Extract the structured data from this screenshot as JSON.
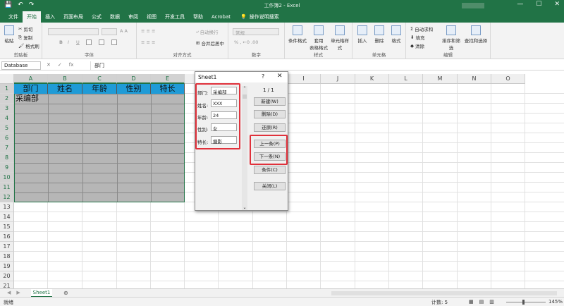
{
  "window": {
    "title": "工作簿2 - Excel",
    "qat": [
      "💾",
      "↶",
      "↷"
    ],
    "controls": [
      "—",
      "☐",
      "✕"
    ]
  },
  "tabs": [
    "文件",
    "开始",
    "插入",
    "页面布局",
    "公式",
    "数据",
    "审阅",
    "视图",
    "开发工具",
    "帮助",
    "Acrobat"
  ],
  "active_tab": "开始",
  "tellme": "操作说明搜索",
  "ribbon": {
    "clipboard": {
      "name": "剪贴板",
      "paste": "粘贴",
      "cut": "剪切",
      "copy": "复制",
      "format_painter": "格式刷"
    },
    "font": {
      "name": "字体",
      "bold": "B",
      "italic": "I",
      "underline": "U"
    },
    "alignment": {
      "name": "对齐方式",
      "wrap": "自动换行",
      "merge": "合并后居中"
    },
    "number": {
      "name": "数字",
      "format": "常规"
    },
    "styles": {
      "name": "样式",
      "conditional": "条件格式",
      "table": "套用\n表格格式",
      "cell_styles": "单元格样式"
    },
    "cells": {
      "name": "单元格",
      "insert": "插入",
      "delete": "删除",
      "format": "格式"
    },
    "editing": {
      "name": "编辑",
      "autosum": "自动求和",
      "fill": "填充",
      "clear": "清除",
      "sort": "排序和筛选",
      "find": "查找和选择"
    }
  },
  "formula_bar": {
    "name_box": "Database",
    "content": "部门",
    "icons": [
      "✕",
      "✓",
      "fx"
    ]
  },
  "columns": [
    "A",
    "B",
    "C",
    "D",
    "E",
    "F",
    "G",
    "H",
    "I",
    "J",
    "K",
    "L",
    "M",
    "N",
    "O"
  ],
  "rows": [
    "1",
    "2",
    "3",
    "4",
    "5",
    "6",
    "7",
    "8",
    "9",
    "10",
    "11",
    "12",
    "13",
    "14",
    "15",
    "16",
    "17",
    "18",
    "19",
    "20",
    "21"
  ],
  "table_headers": [
    "部门",
    "姓名",
    "年龄",
    "性别",
    "特长"
  ],
  "cell_a2": "采编部",
  "dialog": {
    "title": "Sheet1",
    "help": "?",
    "close": "✕",
    "fields": [
      {
        "label": "部门:",
        "value": "采编部"
      },
      {
        "label": "姓名:",
        "value": "XXX"
      },
      {
        "label": "年龄:",
        "value": "24"
      },
      {
        "label": "性别:",
        "value": "女"
      },
      {
        "label": "特长:",
        "value": "摄影"
      }
    ],
    "record": "1 / 1",
    "buttons": [
      "新建(W)",
      "删除(D)",
      "还原(R)",
      "上一条(P)",
      "下一条(N)",
      "条件(C)",
      "关闭(L)"
    ]
  },
  "sheet_tab": "Sheet1",
  "add_sheet": "⊕",
  "status": {
    "ready": "就绪",
    "count": "计数: 5",
    "zoom": "145%"
  },
  "colors": {
    "excel_green": "#217346",
    "header_fill": "#1f9bd7",
    "highlight": "#e0313b"
  }
}
